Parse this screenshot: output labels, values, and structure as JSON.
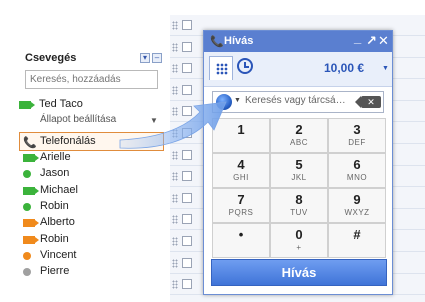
{
  "chat": {
    "title": "Csevegés",
    "minimize": "▾",
    "popout": "–",
    "search_placeholder": "Keresés, hozzáadás",
    "self_name": "Ted Taco",
    "self_status": "Állapot beállítása",
    "self_status_arrow": "▼",
    "phone_label": "Telefonálás",
    "contacts": [
      {
        "name": "Arielle",
        "icon": "video-icon",
        "color": "green"
      },
      {
        "name": "Jason",
        "icon": "status-dot-icon",
        "color": "green"
      },
      {
        "name": "Michael",
        "icon": "video-icon",
        "color": "green"
      },
      {
        "name": "Robin",
        "icon": "status-dot-icon",
        "color": "green"
      },
      {
        "name": "Alberto",
        "icon": "video-icon",
        "color": "orange"
      },
      {
        "name": "Robin",
        "icon": "video-icon",
        "color": "orange"
      },
      {
        "name": "Vincent",
        "icon": "status-dot-icon",
        "color": "orange"
      },
      {
        "name": "Pierre",
        "icon": "status-dot-icon",
        "color": "grey"
      }
    ]
  },
  "dialer": {
    "title": "Hívás",
    "title_icon": "📞",
    "minimize": "_",
    "popout": "↗",
    "close": "✕",
    "credit": "10,00 €",
    "credit_arrow": "▼",
    "country_arrow": "▼",
    "input_placeholder": "Keresés vagy tárcsá…",
    "backspace": "✕",
    "keys": [
      {
        "num": "1",
        "letters": ""
      },
      {
        "num": "2",
        "letters": "ABC"
      },
      {
        "num": "3",
        "letters": "DEF"
      },
      {
        "num": "4",
        "letters": "GHI"
      },
      {
        "num": "5",
        "letters": "JKL"
      },
      {
        "num": "6",
        "letters": "MNO"
      },
      {
        "num": "7",
        "letters": "PQRS"
      },
      {
        "num": "8",
        "letters": "TUV"
      },
      {
        "num": "9",
        "letters": "WXYZ"
      },
      {
        "num": "•",
        "letters": ""
      },
      {
        "num": "0",
        "letters": "+"
      },
      {
        "num": "#",
        "letters": ""
      }
    ],
    "call_button": "Hívás"
  },
  "inbox": {
    "row_count_visible": 13
  },
  "colors": {
    "accent": "#5a7fd0",
    "highlight_border": "#e08c3c",
    "online": "#3bb33b",
    "away": "#f08a1c",
    "offline": "#a0a0a0"
  }
}
